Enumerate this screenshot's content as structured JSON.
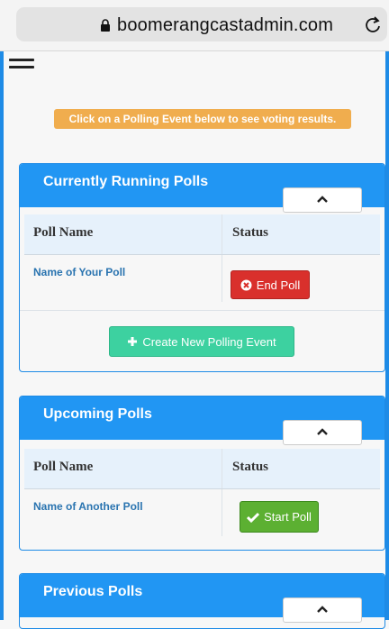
{
  "browser": {
    "url": "boomerangcastadmin.com"
  },
  "notice": "Click on a Polling Event below to see voting results.",
  "panels": {
    "running": {
      "title": "Currently Running Polls",
      "col_name": "Poll Name",
      "col_status": "Status",
      "poll_name": "Name of Your Poll",
      "action_label": "End Poll",
      "create_label": "Create New Polling Event"
    },
    "upcoming": {
      "title": "Upcoming Polls",
      "col_name": "Poll Name",
      "col_status": "Status",
      "poll_name": "Name of Another Poll",
      "action_label": "Start Poll"
    },
    "previous": {
      "title": "Previous Polls"
    }
  },
  "colors": {
    "primary": "#2196f3",
    "warning": "#f0ad4e",
    "danger": "#d9302c",
    "success": "#5cb032",
    "create": "#3dd1a0"
  }
}
